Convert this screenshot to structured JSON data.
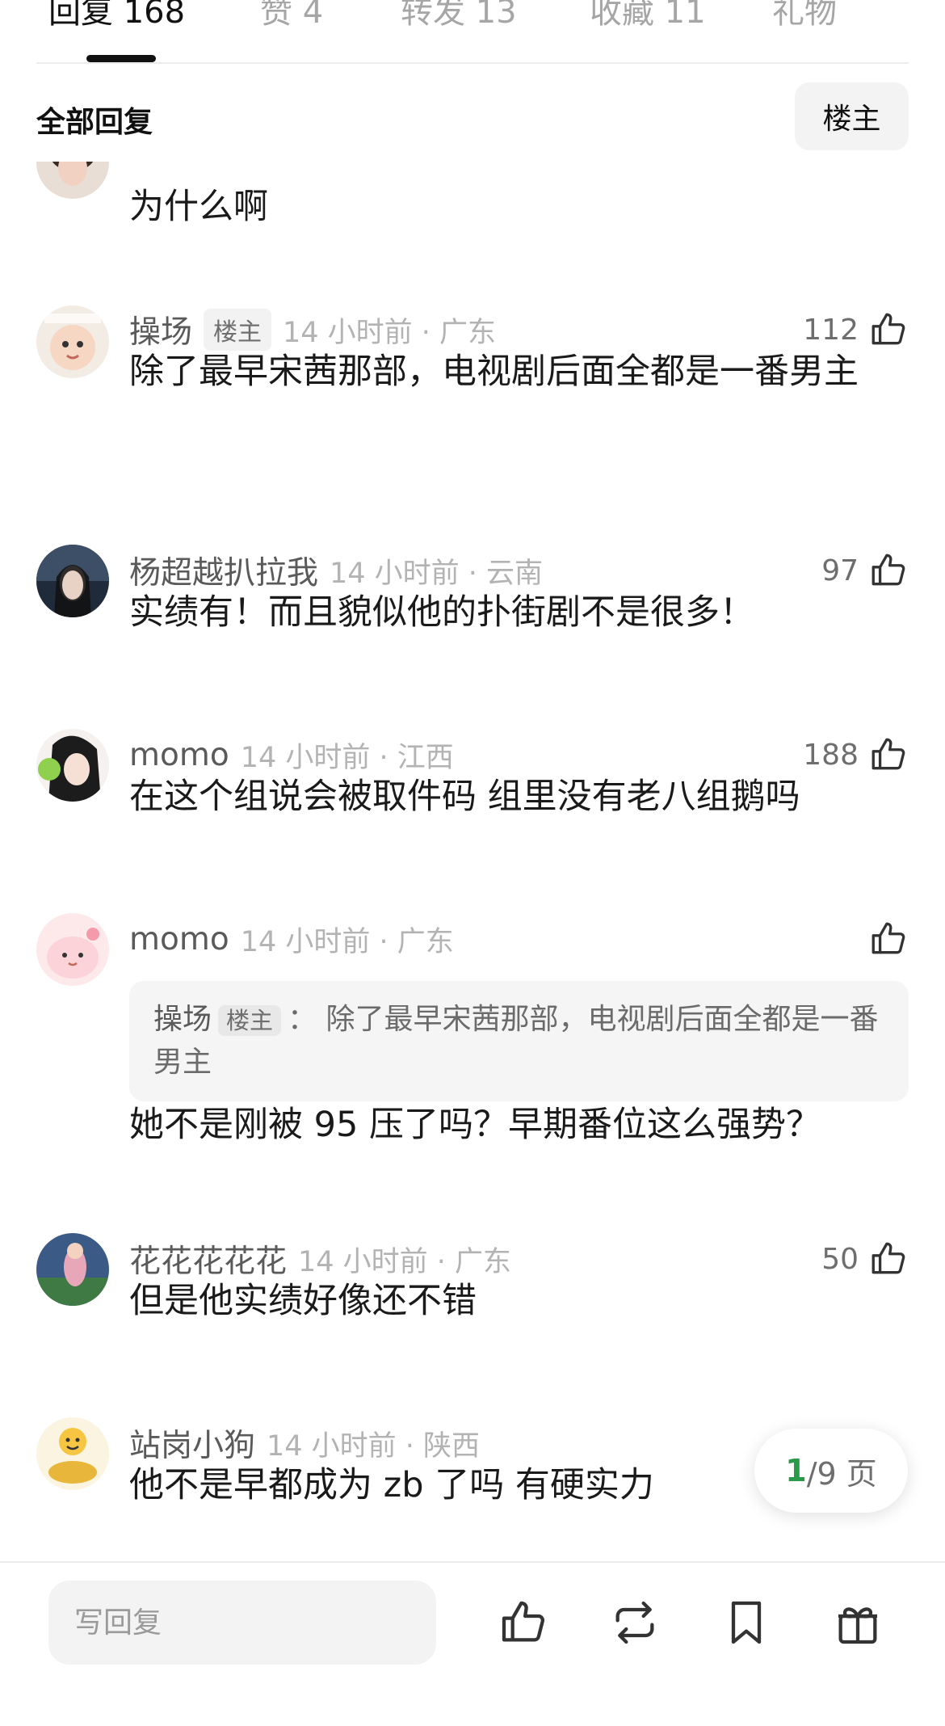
{
  "tabs": [
    {
      "label": "回复 168"
    },
    {
      "label": "赞 4"
    },
    {
      "label": "转发 13"
    },
    {
      "label": "收藏 11"
    },
    {
      "label": "礼物"
    }
  ],
  "filter": {
    "title": "全部回复",
    "button": "楼主"
  },
  "comments": [
    {
      "text": "为什么啊"
    },
    {
      "username": "操场",
      "badge": "楼主",
      "time_loc": "14 小时前 · 广东",
      "likes": "112",
      "text": "除了最早宋茜那部，电视剧后面全都是一番男主"
    },
    {
      "username": "杨超越扒拉我",
      "time_loc": "14 小时前 · 云南",
      "likes": "97",
      "text": "实绩有！而且貌似他的扑街剧不是很多！"
    },
    {
      "username": "momo",
      "time_loc": "14 小时前 · 江西",
      "likes": "188",
      "text": "在这个组说会被取件码 组里没有老八组鹅吗"
    },
    {
      "username": "momo",
      "time_loc": "14 小时前 · 广东",
      "likes": "",
      "quote": {
        "user": "操场",
        "badge": "楼主",
        "sep": "：",
        "text": "除了最早宋茜那部，电视剧后面全都是一番男主"
      },
      "text": "她不是刚被 95 压了吗？早期番位这么强势？"
    },
    {
      "username": "花花花花花",
      "time_loc": "14 小时前 · 广东",
      "likes": "50",
      "text": "但是他实绩好像还不错"
    },
    {
      "username": "站岗小狗",
      "time_loc": "14 小时前 · 陕西",
      "likes": "",
      "text": "他不是早都成为 zb 了吗 有硬实力"
    }
  ],
  "pager": {
    "current": "1",
    "rest": "/9 页"
  },
  "bottom": {
    "reply_placeholder": "写回复"
  },
  "icons": {
    "like": "thumbs-up-icon",
    "repost": "repost-icon",
    "bookmark": "bookmark-icon",
    "gift": "gift-icon"
  },
  "colors": {
    "accent_green": "#2b9b4a",
    "muted": "#b3b3b3",
    "text": "#1a1a1a"
  }
}
